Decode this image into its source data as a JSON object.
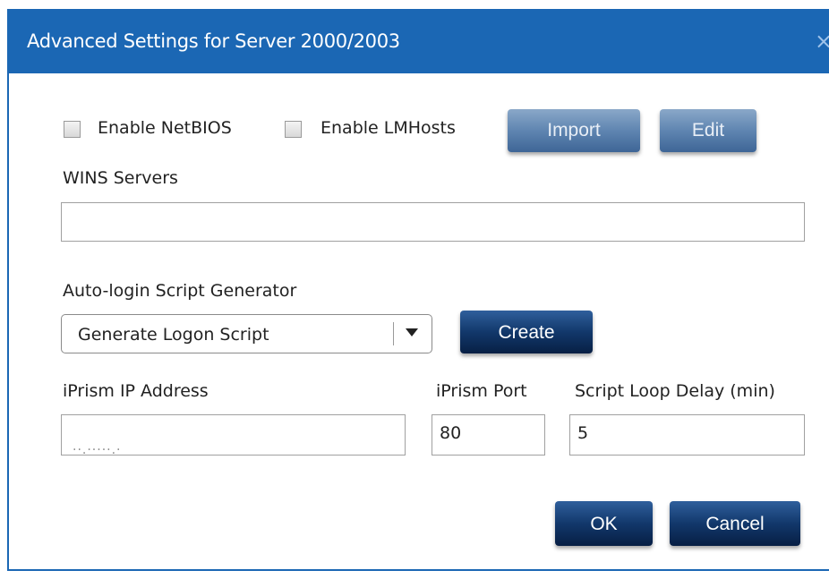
{
  "window": {
    "title": "Advanced Settings for Server 2000/2003",
    "close_glyph": "×"
  },
  "netbios": {
    "enable_netbios_label": "Enable NetBIOS",
    "enable_netbios_checked": false,
    "enable_lmhosts_label": "Enable LMHosts",
    "enable_lmhosts_checked": false,
    "import_label": "Import",
    "edit_label": "Edit"
  },
  "wins": {
    "label": "WINS Servers",
    "value": ""
  },
  "script": {
    "label": "Auto-login Script Generator",
    "selected": "Generate Logon Script",
    "create_label": "Create"
  },
  "iprism": {
    "ip_label": "iPrism IP Address",
    "ip_value": "··.·····.·",
    "port_label": "iPrism Port",
    "port_value": "80",
    "delay_label": "Script Loop Delay (min)",
    "delay_value": "5"
  },
  "actions": {
    "ok_label": "OK",
    "cancel_label": "Cancel"
  },
  "colors": {
    "titlebar": "#1b67b4",
    "button_primary": "#12386b",
    "button_disabled": "#6a8fba"
  },
  "icons": {
    "close": "close-icon",
    "dropdown": "chevron-down-icon"
  }
}
